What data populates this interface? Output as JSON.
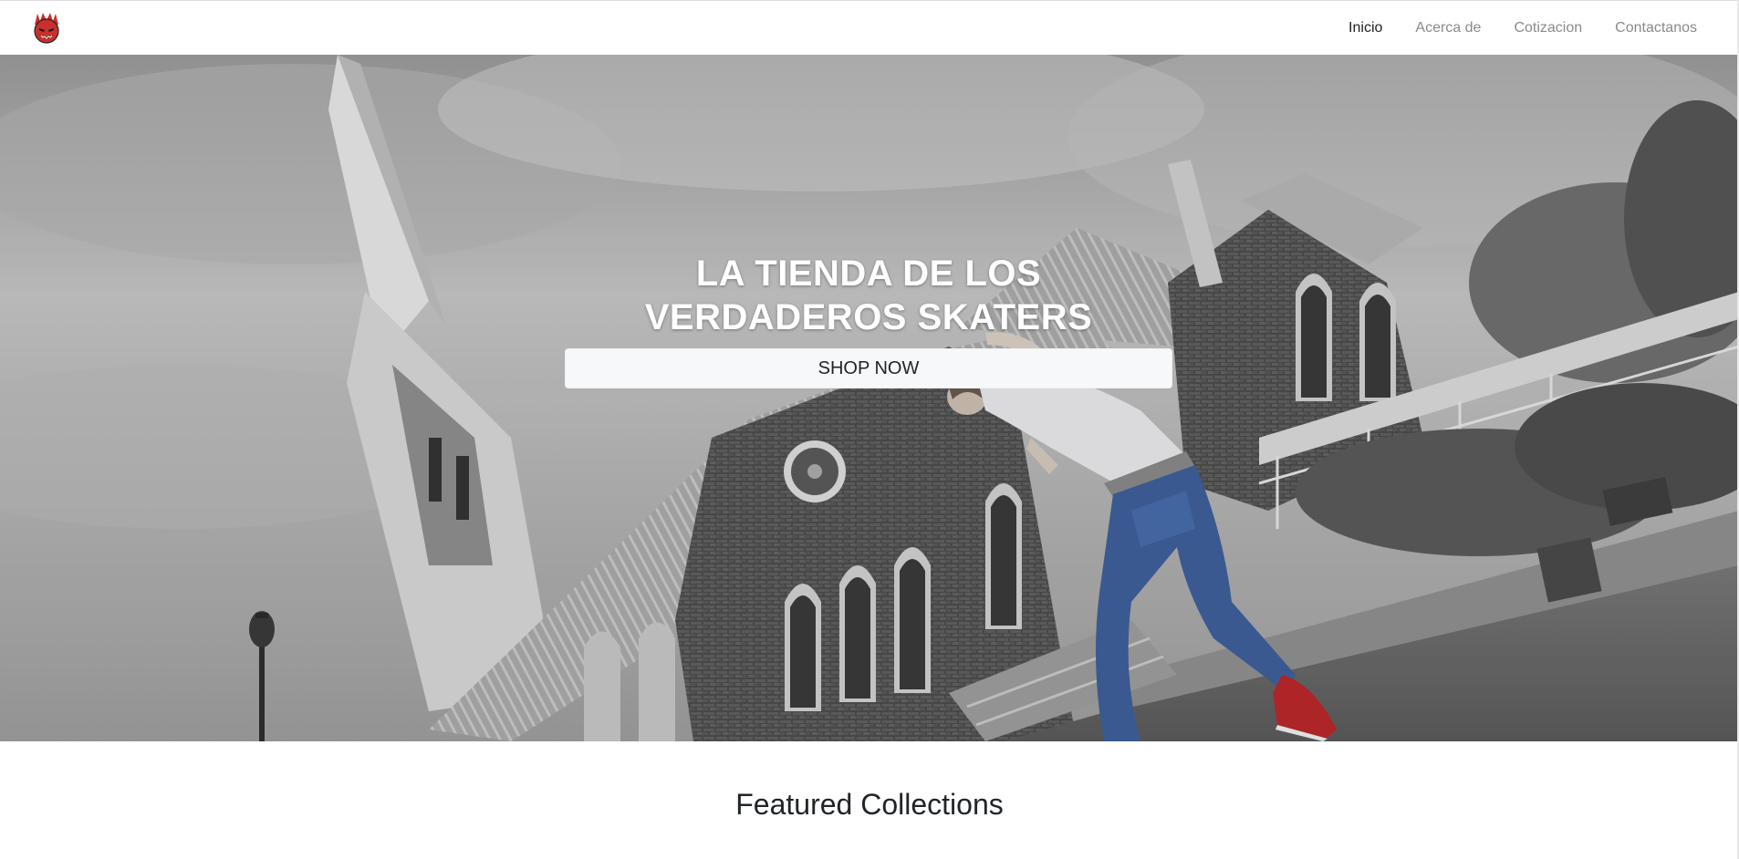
{
  "navbar": {
    "logo_icon": "devil-flame-logo-icon",
    "links": [
      {
        "label": "Inicio",
        "active": true
      },
      {
        "label": "Acerca de",
        "active": false
      },
      {
        "label": "Cotizacion",
        "active": false
      },
      {
        "label": "Contactanos",
        "active": false
      }
    ]
  },
  "hero": {
    "title": "LA TIENDA DE LOS VERDADEROS SKATERS",
    "button_label": "SHOP NOW",
    "background": "grayscale photo: skateboarder in front of a stone church"
  },
  "featured": {
    "title": "Featured Collections"
  },
  "colors": {
    "logo_red": "#c8302c",
    "nav_active": "#222222",
    "nav_inactive": "#8a8a8a",
    "button_bg": "#f7f8fa",
    "jeans_blue": "#3d5f9a",
    "shoe_red": "#b8282a"
  }
}
